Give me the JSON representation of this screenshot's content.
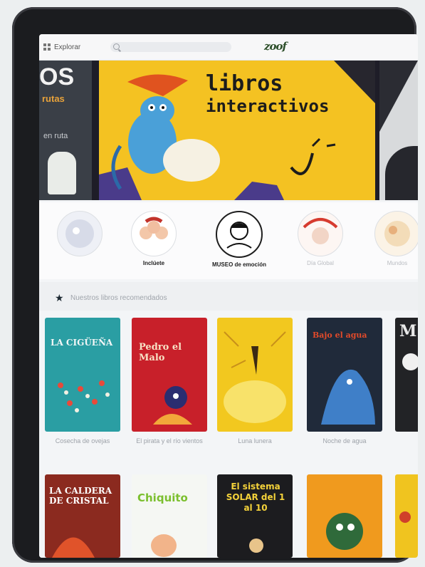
{
  "topbar": {
    "explore_label": "Explorar",
    "search_placeholder": "",
    "logo_text": "zoof"
  },
  "hero": {
    "title": "libros",
    "subtitle": "interactivos",
    "prev_big": "OS",
    "prev_sub": "rutas",
    "prev_small": "en ruta"
  },
  "circles": [
    {
      "label": "",
      "faint": true
    },
    {
      "label": "Inclúete",
      "faint": false
    },
    {
      "label": "MUSEO de emoción",
      "faint": false
    },
    {
      "label": "Día Global",
      "faint": true
    },
    {
      "label": "Mundos",
      "faint": true
    }
  ],
  "section": {
    "title": "Nuestros libros recomendados"
  },
  "books": [
    {
      "cover_text": "LA CIGÜEÑA",
      "title": "Cosecha de ovejas",
      "cover_color": "#2a9ea3"
    },
    {
      "cover_text": "Pedro el Malo",
      "title": "El pirata y el río vientos",
      "cover_color": "#c8202a"
    },
    {
      "cover_text": "",
      "title": "Luna lunera",
      "cover_color": "#f2c81f"
    },
    {
      "cover_text": "Bajo el agua",
      "title": "Noche de agua",
      "cover_color": "#202a3a"
    },
    {
      "cover_text": "M",
      "title": "",
      "cover_color": "#222326"
    }
  ],
  "books_row2": [
    {
      "cover_text": "LA CALDERA DE CRISTAL",
      "cover_color": "#8b2a1f"
    },
    {
      "cover_text": "Chiquito",
      "cover_color": "#f5f7f3"
    },
    {
      "cover_text": "El sistema SOLAR del 1 al 10",
      "cover_color": "#1c1c1f"
    },
    {
      "cover_text": "",
      "cover_color": "#f09a1e"
    },
    {
      "cover_text": "",
      "cover_color": "#f0c41f"
    }
  ]
}
